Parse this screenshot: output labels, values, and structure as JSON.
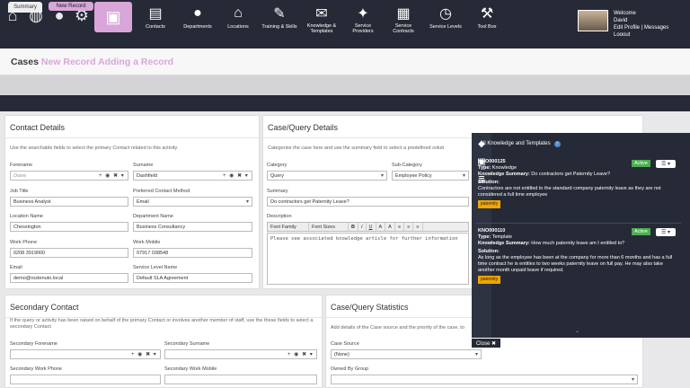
{
  "nav": {
    "items": [
      {
        "label": "Contacts",
        "icon": "contacts-icon",
        "glyph": "▤"
      },
      {
        "label": "Departments",
        "icon": "departments-icon",
        "glyph": "●"
      },
      {
        "label": "Locations",
        "icon": "locations-icon",
        "glyph": "⌂"
      },
      {
        "label": "Training & Skills",
        "icon": "training-icon",
        "glyph": "✎"
      },
      {
        "label": "Knowledge & Templates",
        "icon": "knowledge-icon",
        "glyph": "✉"
      },
      {
        "label": "Service Providers",
        "icon": "service-providers-icon",
        "glyph": "✦"
      },
      {
        "label": "Service Contracts",
        "icon": "service-contracts-icon",
        "glyph": "▦"
      },
      {
        "label": "Service Levels",
        "icon": "service-levels-icon",
        "glyph": "◷"
      },
      {
        "label": "Tool Box",
        "icon": "toolbox-icon",
        "glyph": "⚒"
      }
    ]
  },
  "user": {
    "welcome": "Welcome",
    "name": "David",
    "edit_profile": "Edit Profile | Messages",
    "logout": "Logout"
  },
  "tabs": {
    "summary": "Summary",
    "new_record": "New Record"
  },
  "page": {
    "title": "Cases",
    "subtitle": "New Record Adding a Record"
  },
  "contact": {
    "title": "Contact Details",
    "hint": "Use the searchable fields to select the primary Contact related to this activity.",
    "forename_label": "Forename",
    "forename_placeholder": "Diane",
    "surname_label": "Surname",
    "surname_value": "Dashfield",
    "job_title_label": "Job Title",
    "job_title_value": "Business Analyst",
    "pref_contact_label": "Preferred Contact Method",
    "pref_contact_value": "Email",
    "location_label": "Location Name",
    "location_value": "Chessington",
    "department_label": "Department Name",
    "department_value": "Business Consultancy",
    "work_phone_label": "Work Phone",
    "work_phone_value": "0208 3919000",
    "work_mobile_label": "Work Mobile",
    "work_mobile_value": "07917 038548",
    "email_label": "Email",
    "email_value": "demo@rostenuto.local",
    "sla_label": "Service Level Name",
    "sla_value": "Default SLA Agreement"
  },
  "case": {
    "title": "Case/Query Details",
    "hint": "Categorise the case here and use the summary field to select a predefined soluti",
    "category_label": "Category",
    "category_value": "Query",
    "subcategory_label": "Sub-Category",
    "subcategory_value": "Employee Policy",
    "summary_label": "Summary",
    "summary_value": "Do contractors get Paternity Leave?",
    "description_label": "Description",
    "font_family": "Font Family",
    "font_sizes": "Font Sizes",
    "description_text": "Please see associated knowledge article for further information"
  },
  "secondary": {
    "title": "Secondary Contact",
    "hint": "If the query or activity has been raised on behalf of the primary Contact or involves another member of staff, use the these fields to select a secondary Contact",
    "forename_label": "Secondary Forename",
    "surname_label": "Secondary Surname",
    "work_phone_label": "Secondary Work Phone",
    "work_mobile_label": "Secondary Work Mobile"
  },
  "stats": {
    "title": "Case/Query Statistics",
    "hint": "Add details of the Case source and the priority of the case, to",
    "source_label": "Case Source",
    "source_value": "(None)",
    "owned_label": "Owned By Group"
  },
  "knowledge": {
    "header": "All Knowledge and Templates",
    "articles": [
      {
        "id": "KNO000125",
        "status": "Active",
        "type_label": "Type:",
        "type": "Knowledge",
        "summary_label": "Knowledge Summary:",
        "summary": "Do contractors get Paternity Leave?",
        "solution_label": "Solution:",
        "solution": "Contractors are not entitled to the standard company paternity leave as they are not considered a full time employee",
        "tag": "paternity"
      },
      {
        "id": "KNO000110",
        "status": "Active",
        "type_label": "Type:",
        "type": "Template",
        "summary_label": "Knowledge Summary:",
        "summary": "How much paternity leave am I entitled to?",
        "solution_label": "Solution:",
        "solution": "As long as the employee has been at the company for more than 6 months and has a full time contract he is entitles to two weeks paternity leave on full pay. He may also take another month unpaid leave if required.",
        "tag": "paternity"
      }
    ],
    "close": "Close ✖"
  }
}
